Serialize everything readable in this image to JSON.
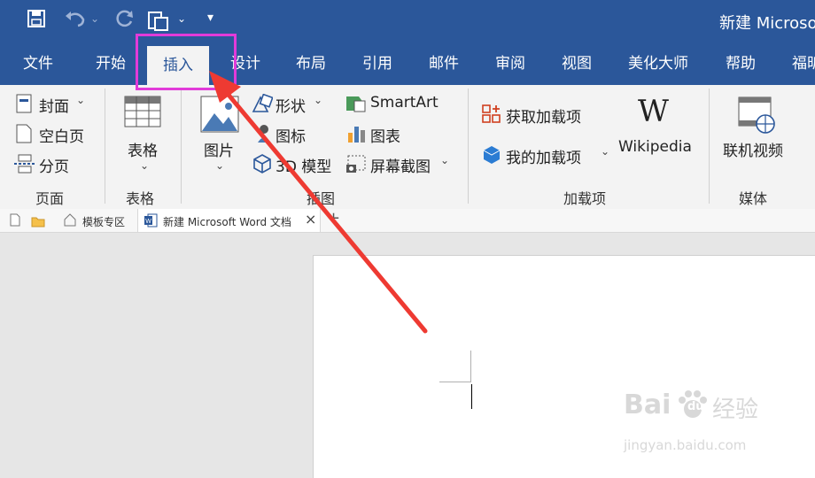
{
  "window": {
    "title": "新建 Microso"
  },
  "colors": {
    "accent": "#2b579a",
    "highlight": "#e13bd9",
    "arrow": "#ee3a32"
  },
  "qat": {
    "save_icon": "save-icon",
    "undo_icon": "undo-icon",
    "redo_icon": "redo-icon",
    "newdoc_icon": "new-document-icon",
    "dropdown_glyph": "⌄",
    "customize_glyph": "▾"
  },
  "tabs": [
    "文件",
    "开始",
    "插入",
    "设计",
    "布局",
    "引用",
    "邮件",
    "审阅",
    "视图",
    "美化大师",
    "帮助",
    "福昕"
  ],
  "ribbon": {
    "pages": {
      "cover": "封面",
      "blank": "空白页",
      "break": "分页",
      "group": "页面"
    },
    "tables": {
      "table": "表格",
      "group": "表格"
    },
    "illustrations": {
      "picture": "图片",
      "shapes": "形状",
      "icons": "图标",
      "model3d": "3D 模型",
      "smartart": "SmartArt",
      "chart": "图表",
      "screenshot": "屏幕截图",
      "group": "插图"
    },
    "addins": {
      "get": "获取加载项",
      "mine": "我的加载项",
      "wikipedia": "Wikipedia",
      "wiki_glyph": "W",
      "group": "加载项"
    },
    "media": {
      "video": "联机视频",
      "group": "媒体"
    },
    "dropdown_glyph": "⌄"
  },
  "doctabs": {
    "templates": "模板专区",
    "document": "新建 Microsoft Word 文档",
    "close_glyph": "×",
    "add_glyph": "+"
  },
  "watermark": {
    "brand": "Bai",
    "brand2": "du",
    "product": "经验",
    "url": "jingyan.baidu.com"
  }
}
